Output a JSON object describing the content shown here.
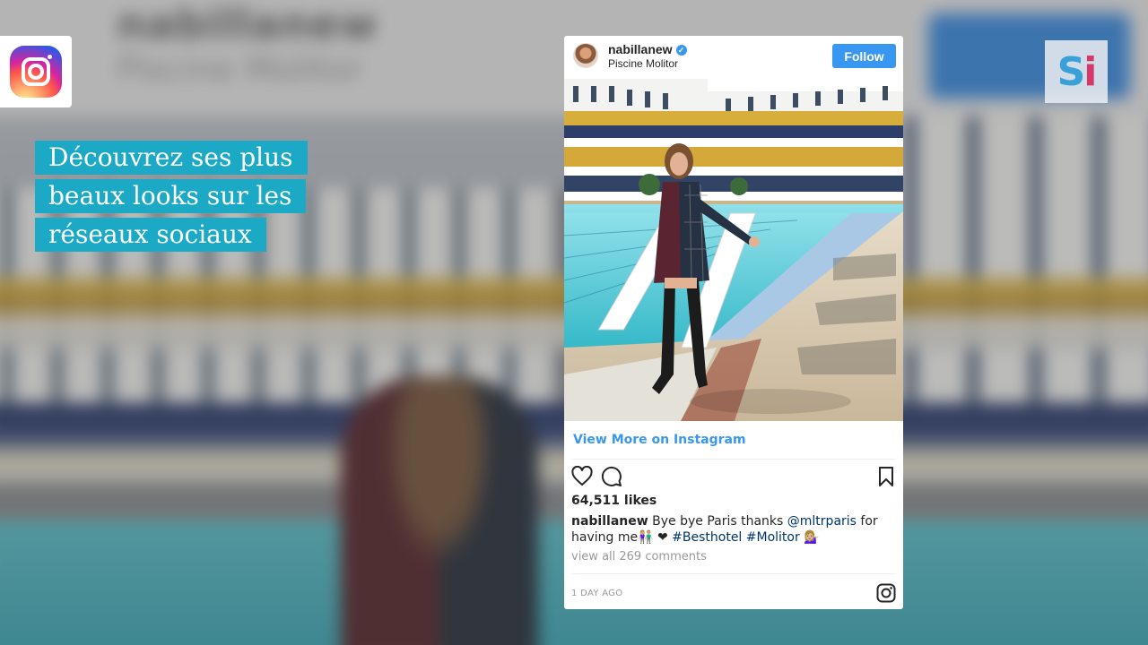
{
  "background": {
    "blurred_username": "nabillanew",
    "blurred_location": "Piscine Molitor",
    "blurred_button": "Follow"
  },
  "overlay": {
    "left_logo": "instagram-icon",
    "right_logo_text": {
      "s": "S",
      "i": "i"
    },
    "caption_lines": [
      "Découvrez ses plus",
      "beaux looks sur les",
      "réseaux sociaux"
    ],
    "caption_color": "#1ba9c6"
  },
  "post": {
    "username": "nabillanew",
    "verified_icon": "verified-check-icon",
    "location": "Piscine Molitor",
    "follow_label": "Follow",
    "view_more_label": "View More on Instagram",
    "likes": "64,511 likes",
    "caption_user": "nabillanew",
    "caption_text_1": " Bye bye Paris thanks ",
    "caption_mention": "@mltrparis",
    "caption_text_2": " for having me",
    "caption_emoji": "👫🏼 ❤ ",
    "caption_tag1": "#Besthotel",
    "caption_tag2": " #Molitor",
    "caption_end": " 💁🏼‍♀️",
    "view_all_comments": "view all 269 comments",
    "timestamp": "1 DAY AGO",
    "accent": "#3897f0"
  }
}
